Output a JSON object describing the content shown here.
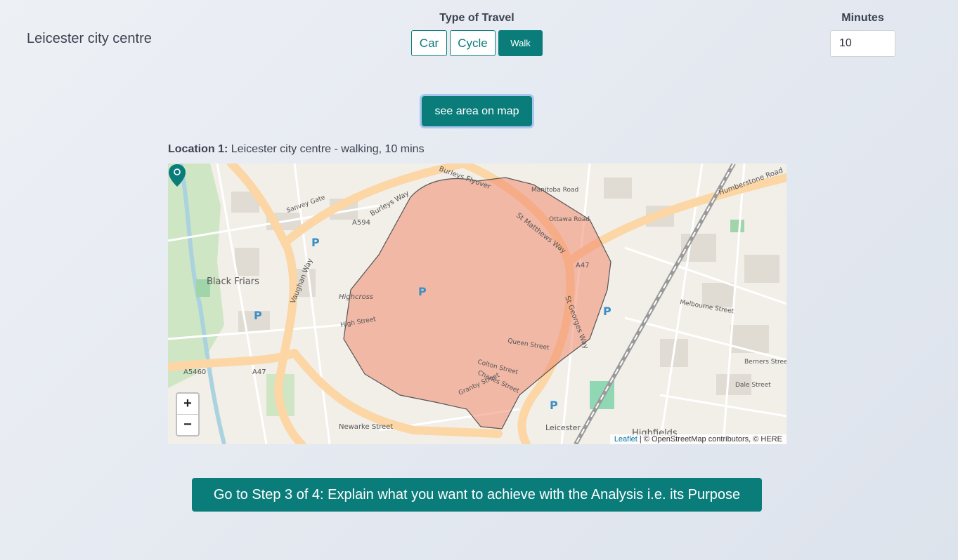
{
  "location": {
    "title": "Leicester city centre"
  },
  "travel": {
    "label": "Type of Travel",
    "options": [
      {
        "label": "Car",
        "selected": false
      },
      {
        "label": "Cycle",
        "selected": false
      },
      {
        "label": "Walk",
        "selected": true
      }
    ]
  },
  "minutes": {
    "label": "Minutes",
    "value": "10"
  },
  "actions": {
    "see_area": "see area on map",
    "next_step": "Go to Step 3 of 4: Explain what you want to achieve with the Analysis i.e. its Purpose"
  },
  "summary": {
    "prefix": "Location 1:",
    "text": "Leicester city centre - walking, 10 mins"
  },
  "map": {
    "zoom_in": "+",
    "zoom_out": "−",
    "attribution_leaflet": "Leaflet",
    "attribution_rest": "| © OpenStreetMap contributors, © HERE",
    "labels": {
      "burleys_flyover": "Burleys Flyover",
      "burleys_way": "Burleys Way",
      "st_matthews_way": "St Matthews Way",
      "humberstone_road": "Humberstone Road",
      "vaughan_way": "Vaughan Way",
      "black_friars": "Black Friars",
      "highcross": "Highcross",
      "st_georges_way": "St Georges Way",
      "a594": "A594",
      "a47": "A47",
      "a47_b": "A47",
      "a5460": "A5460",
      "newarke_street": "Newarke Street",
      "leicester": "Leicester",
      "high_street": "High Street",
      "queen_street": "Queen Street",
      "sanvey_gate": "Sanvey Gate",
      "manitoba_road": "Manitoba Road",
      "ottawa_road": "Ottawa Road",
      "melbourne_street": "Melbourne Street",
      "dale_street": "Dale Street",
      "berners_street": "Berners Street",
      "colton_street": "Colton Street",
      "granby_street": "Granby Street",
      "charles_street": "Charles Street",
      "highfields": "Highfields"
    }
  },
  "colors": {
    "accent": "#0a7d7b",
    "isochrone": "#f08a70"
  }
}
